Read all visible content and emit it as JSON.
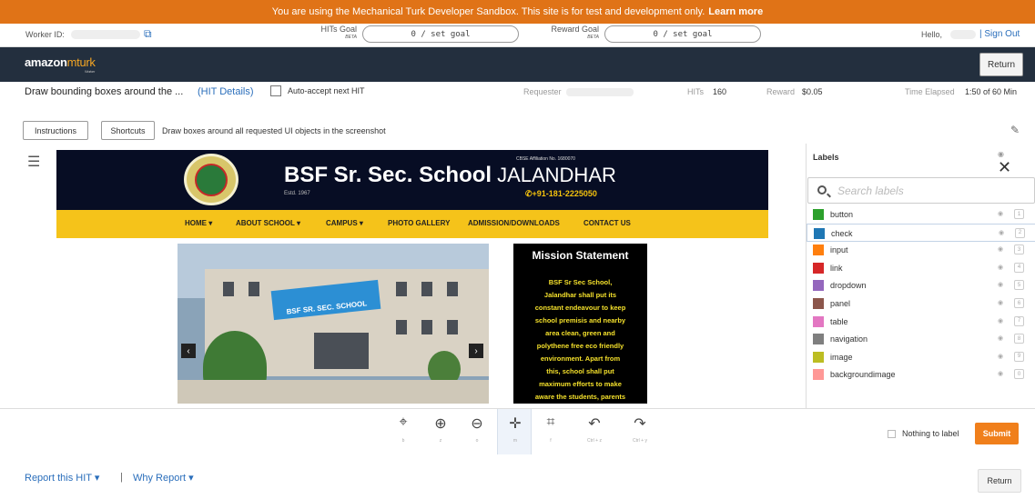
{
  "banner": {
    "text": "You are using the Mechanical Turk Developer Sandbox. This site is for test and development only.",
    "link": "Learn more"
  },
  "worker_bar": {
    "worker_id_label": "Worker ID:",
    "hits_goal_label": "HITs Goal",
    "hits_goal_badge": "BETA",
    "hits_goal_value": "0  /  set goal",
    "reward_goal_label": "Reward Goal",
    "reward_goal_badge": "BETA",
    "reward_goal_value": "0  /  set goal",
    "hello": "Hello,",
    "sign_out": "| Sign Out"
  },
  "mturk_bar": {
    "logo_amazon": "amazon",
    "logo_mturk": "mturk",
    "logo_worker": "Worker",
    "return_label": "Return"
  },
  "task_bar": {
    "title": "Draw bounding boxes around the ...",
    "hit_details": "(HIT Details)",
    "auto_accept": "Auto-accept next HIT",
    "requester_label": "Requester",
    "hits_label": "HITs",
    "hits_value": "160",
    "reward_label": "Reward",
    "reward_value": "$0.05",
    "time_label": "Time Elapsed",
    "time_value": "1:50 of 60 Min"
  },
  "instructions_row": {
    "instructions_btn": "Instructions",
    "shortcuts_btn": "Shortcuts",
    "text": "Draw boxes around all requested UI objects in the screenshot"
  },
  "screenshot": {
    "affiliation": "CBSE Affiliation No. 1680070",
    "school_name": "BSF Sr. Sec. School",
    "city": "JALANDHAR",
    "estd": "Estd. 1967",
    "phone": "✆+91-181-2225050",
    "nav": [
      "HOME  ▾",
      "ABOUT SCHOOL  ▾",
      "CAMPUS  ▾",
      "PHOTO GALLERY",
      "ADMISSION/DOWNLOADS",
      "CONTACT US"
    ],
    "sign_text": "BSF SR. SEC. SCHOOL",
    "prev_icon": "chevron-left-icon",
    "next_icon": "chevron-right-icon",
    "mission_title": "Mission Statement",
    "mission_lines": [
      "BSF Sr Sec School,",
      "Jalandhar shall put its",
      "constant endeavour to keep",
      "school premisis and nearby",
      "area clean, green and",
      "polythene free eco friendly",
      "environment. Apart from",
      "this, school shall put",
      "maximum efforts to make",
      "aware the students, parents"
    ]
  },
  "labels_panel": {
    "title": "Labels",
    "search_placeholder": "Search labels",
    "items": [
      {
        "name": "button",
        "color": "#2ca02c",
        "key": "1"
      },
      {
        "name": "check",
        "color": "#1f77b4",
        "key": "2"
      },
      {
        "name": "input",
        "color": "#ff7f0e",
        "key": "3"
      },
      {
        "name": "link",
        "color": "#d62728",
        "key": "4"
      },
      {
        "name": "dropdown",
        "color": "#9467bd",
        "key": "5"
      },
      {
        "name": "panel",
        "color": "#8c564b",
        "key": "6"
      },
      {
        "name": "table",
        "color": "#e377c2",
        "key": "7"
      },
      {
        "name": "navigation",
        "color": "#7f7f7f",
        "key": "8"
      },
      {
        "name": "image",
        "color": "#bcbd22",
        "key": "9"
      },
      {
        "name": "backgroundimage",
        "color": "#ff9896",
        "key": "0"
      }
    ]
  },
  "toolbar": {
    "tools": [
      {
        "icon": "⌖",
        "key": "b",
        "name": "box-tool"
      },
      {
        "icon": "⊕",
        "key": "z",
        "name": "zoom-in-tool"
      },
      {
        "icon": "⊖",
        "key": "o",
        "name": "zoom-out-tool"
      },
      {
        "icon": "✛",
        "key": "m",
        "name": "move-tool"
      },
      {
        "icon": "⌗",
        "key": "f",
        "name": "fit-tool"
      },
      {
        "icon": "↶",
        "key": "Ctrl + z",
        "name": "undo-tool"
      },
      {
        "icon": "↷",
        "key": "Ctrl + y",
        "name": "redo-tool"
      }
    ],
    "nothing_to_label": "Nothing to label",
    "submit": "Submit"
  },
  "footer": {
    "report": "Report this HIT ▾",
    "separator": "|",
    "why": "Why Report ▾",
    "return_label": "Return"
  }
}
